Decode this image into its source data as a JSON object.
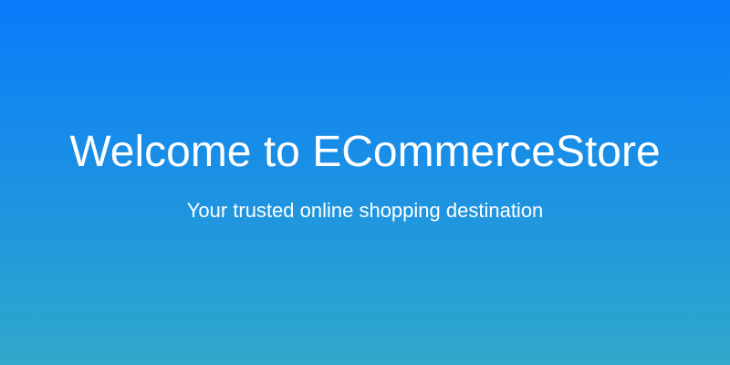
{
  "hero": {
    "title": "Welcome to ECommerceStore",
    "subtitle": "Your trusted online shopping destination"
  },
  "colors": {
    "gradient_top": "#087cfb",
    "gradient_bottom": "#30a9ca",
    "text": "#ffffff"
  }
}
